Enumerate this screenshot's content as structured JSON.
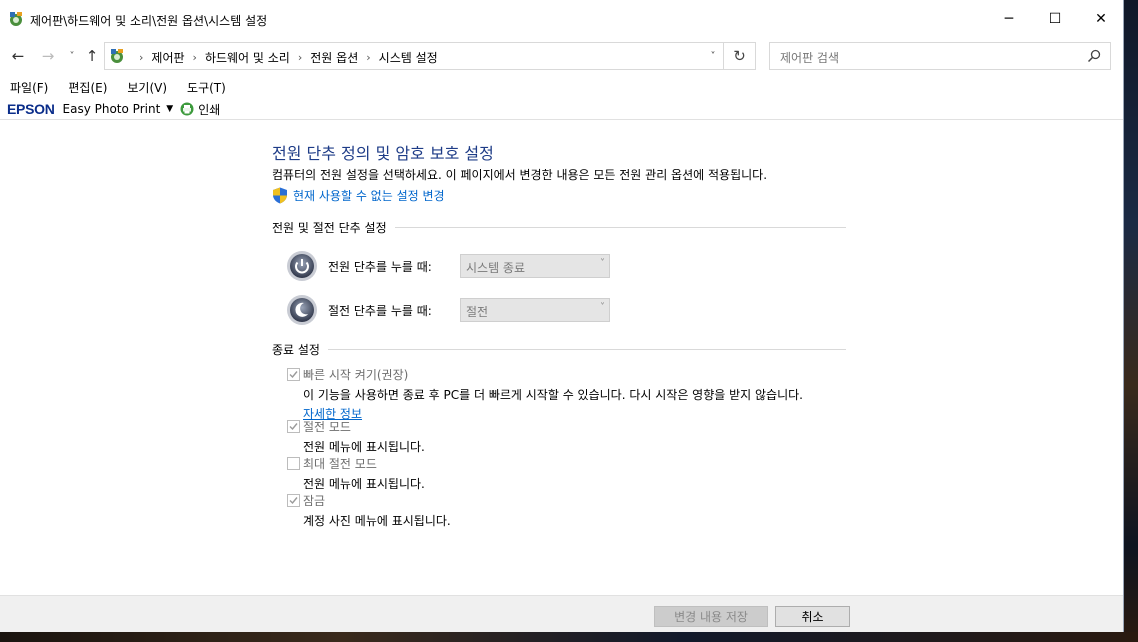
{
  "window": {
    "title": "제어판\\하드웨어 및 소리\\전원 옵션\\시스템 설정",
    "minimize": "─",
    "maximize": "☐",
    "close": "✕"
  },
  "nav": {
    "back": "←",
    "forward": "→",
    "recent": "˅",
    "up": "↑",
    "breadcrumbs": [
      {
        "label": "제어판"
      },
      {
        "label": "하드웨어 및 소리"
      },
      {
        "label": "전원 옵션"
      },
      {
        "label": "시스템 설정"
      }
    ],
    "separator": "›",
    "dropdown": "˅",
    "refresh": "↻",
    "search_placeholder": "제어판 검색"
  },
  "menu": {
    "items": [
      "파일(F)",
      "편집(E)",
      "보기(V)",
      "도구(T)"
    ]
  },
  "epson": {
    "logo": "EPSON",
    "app": "Easy Photo Print",
    "dropdown": "▼",
    "print": "인쇄"
  },
  "main": {
    "title": "전원 단추 정의 및 암호 보호 설정",
    "description": "컴퓨터의 전원 설정을 선택하세요. 이 페이지에서 변경한 내용은 모든 전원 관리 옵션에 적용됩니다.",
    "change_link": "현재 사용할 수 없는 설정 변경",
    "section_buttons": "전원 및 절전 단추 설정",
    "power_button": {
      "label": "전원 단추를 누를 때:",
      "value": "시스템 종료"
    },
    "sleep_button": {
      "label": "절전 단추를 누를 때:",
      "value": "절전"
    },
    "dropdown_arrow": "˅",
    "section_shutdown": "종료 설정",
    "options": {
      "fast_startup": {
        "label": "빠른 시작 켜기(권장)",
        "description": "이 기능을 사용하면 종료 후 PC를 더 빠르게 시작할 수 있습니다. 다시 시작은 영향을 받지 않습니다.",
        "link": "자세한 정보",
        "checked": true
      },
      "sleep": {
        "label": "절전 모드",
        "description": "전원 메뉴에 표시됩니다.",
        "checked": true
      },
      "hibernate": {
        "label": "최대 절전 모드",
        "description": "전원 메뉴에 표시됩니다.",
        "checked": false
      },
      "lock": {
        "label": "잠금",
        "description": "계정 사진 메뉴에 표시됩니다.",
        "checked": true
      }
    }
  },
  "footer": {
    "save": "변경 내용 저장",
    "cancel": "취소"
  },
  "colors": {
    "title": "#1e3c87",
    "link": "#0066cc",
    "epson": "#0a2d8a"
  }
}
